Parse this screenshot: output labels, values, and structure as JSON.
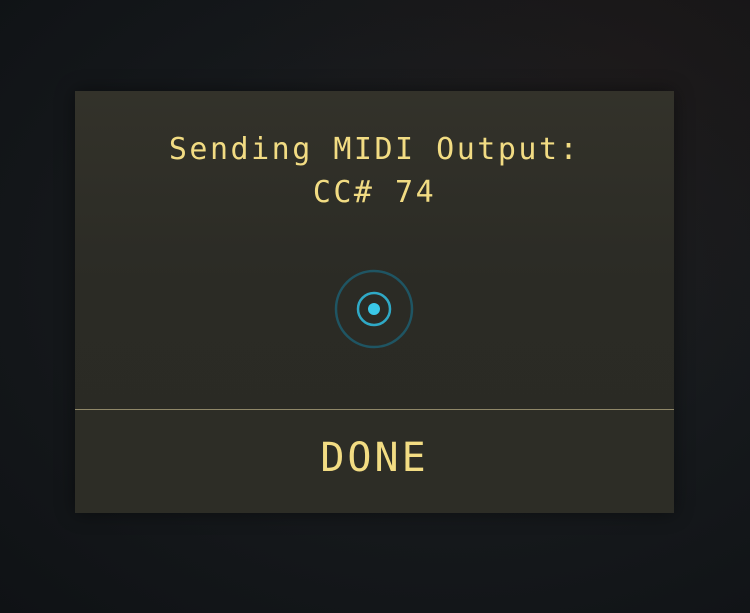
{
  "dialog": {
    "title": "Sending MIDI Output:",
    "value": "CC# 74",
    "done_label": "DONE"
  },
  "indicator": {
    "icon": "midi-activity-icon",
    "color_ring": "#1f5f69",
    "color_dot": "#35c6e6"
  },
  "colors": {
    "text": "#f2dc83",
    "panel": "#2e2d27",
    "divider": "#8f8768"
  }
}
